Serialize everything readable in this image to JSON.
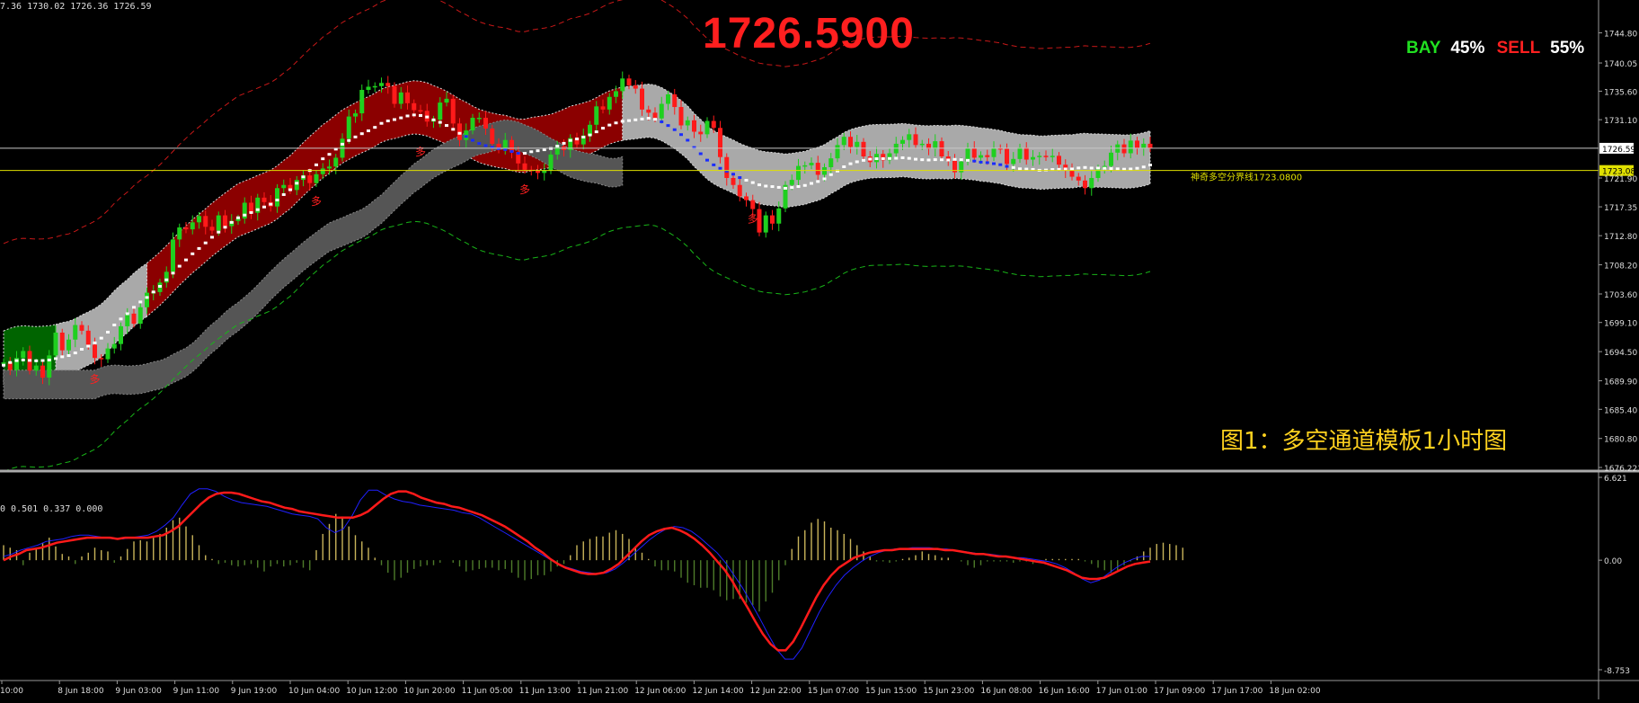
{
  "header": {
    "ohlc_text": "7.36 1730.02 1726.36 1726.59",
    "big_price": "1726.5900",
    "buy_label": "BAY",
    "buy_pct": "45%",
    "sell_label": "SELL",
    "sell_pct": "55%",
    "caption": "图1：多空通道模板1小时图"
  },
  "indicator": {
    "values_text": "0 0.501 0.337 0.000",
    "yticks": [
      "6.621",
      "0.00",
      "-8.753"
    ]
  },
  "colors": {
    "background": "#000000",
    "bull": "#1fd01f",
    "bear": "#ff1a1a",
    "red_band": "#8b0000",
    "green_band": "#006400",
    "gray_band": "#a9a9a9",
    "dark_band": "#555555",
    "price_line": "#c8c8c8",
    "threshold_line": "#e0e000",
    "caption": "#ffd21f"
  },
  "chart_data": {
    "type": "candlestick",
    "title": "",
    "price_ylim": [
      1676.221,
      1748.0
    ],
    "price_yticks": [
      1744.8,
      1740.05,
      1735.6,
      1731.1,
      1726.59,
      1723.08,
      1721.9,
      1717.35,
      1712.8,
      1708.2,
      1703.6,
      1699.1,
      1694.5,
      1689.9,
      1685.4,
      1680.8,
      1676.22
    ],
    "price_ytick_labels": [
      "1744.80",
      "1740.05",
      "1735.60",
      "1731.10",
      "1726.59",
      "1723.08",
      "1721.90",
      "1717.35",
      "1712.80",
      "1708.20",
      "1703.60",
      "1699.10",
      "1694.50",
      "1689.90",
      "1685.40",
      "1680.80",
      "1676.221"
    ],
    "current_price": 1726.59,
    "threshold": {
      "value": 1723.08,
      "label": "神奇多空分界线1723.0800"
    },
    "xticks": [
      "10:00",
      "8 Jun 18:00",
      "9 Jun 03:00",
      "9 Jun 11:00",
      "9 Jun 19:00",
      "10 Jun 04:00",
      "10 Jun 12:00",
      "10 Jun 20:00",
      "11 Jun 05:00",
      "11 Jun 13:00",
      "11 Jun 21:00",
      "12 Jun 06:00",
      "12 Jun 14:00",
      "12 Jun 22:00",
      "15 Jun 07:00",
      "15 Jun 15:00",
      "15 Jun 23:00",
      "16 Jun 08:00",
      "16 Jun 16:00",
      "17 Jun 01:00",
      "17 Jun 09:00",
      "17 Jun 17:00",
      "18 Jun 02:00"
    ],
    "arrow_label": "多",
    "arrows_at": [
      14,
      48,
      64,
      80,
      115,
      178,
      196,
      224
    ],
    "closes": [
      1692.8,
      1691.6,
      1693.5,
      1694.6,
      1691.5,
      1692.3,
      1690.4,
      1693.9,
      1697.5,
      1694.7,
      1696.4,
      1698.7,
      1697.8,
      1695.6,
      1693.5,
      1693.3,
      1695.0,
      1695.7,
      1698.5,
      1700.5,
      1698.9,
      1701.5,
      1703.8,
      1703.9,
      1705.4,
      1707.1,
      1712.2,
      1714.1,
      1713.8,
      1714.9,
      1715.9,
      1714.2,
      1713.6,
      1716.0,
      1714.3,
      1715.1,
      1715.5,
      1718.0,
      1716.4,
      1718.8,
      1718.1,
      1717.4,
      1720.3,
      1720.8,
      1720.0,
      1721.6,
      1722.3,
      1721.1,
      1722.5,
      1723.4,
      1723.7,
      1725.1,
      1728.1,
      1731.6,
      1732.1,
      1735.8,
      1736.3,
      1736.4,
      1736.9,
      1736.4,
      1733.6,
      1735.4,
      1733.7,
      1732.6,
      1732.5,
      1730.8,
      1731.1,
      1733.8,
      1734.4,
      1730.5,
      1727.9,
      1729.4,
      1731.4,
      1731.4,
      1729.7,
      1727.3,
      1726.4,
      1727.9,
      1726.0,
      1724.2,
      1723.2,
      1723.1,
      1722.7,
      1723.1,
      1725.6,
      1726.9,
      1726.3,
      1728.2,
      1727.2,
      1728.6,
      1730.3,
      1733.2,
      1732.7,
      1734.7,
      1735.6,
      1737.6,
      1736.5,
      1736.0,
      1732.7,
      1732.2,
      1731.3,
      1733.6,
      1735.1,
      1733.1,
      1730.2,
      1731.0,
      1729.2,
      1728.8,
      1730.9,
      1729.8,
      1725.2,
      1721.9,
      1720.8,
      1719.0,
      1718.4,
      1717.0,
      1713.3,
      1716.0,
      1714.7,
      1717.1,
      1720.8,
      1721.6,
      1723.8,
      1723.9,
      1724.3,
      1722.4,
      1723.6,
      1725.0,
      1727.1,
      1728.4,
      1726.8,
      1727.6,
      1725.3,
      1724.4,
      1725.7,
      1724.7,
      1725.8,
      1727.3,
      1727.9,
      1728.8,
      1727.1,
      1727.3,
      1726.5,
      1727.7,
      1725.3,
      1724.6,
      1722.8,
      1724.5,
      1726.6,
      1725.1,
      1725.5,
      1725.2,
      1726.6,
      1726.5,
      1724.1,
      1724.9,
      1726.7,
      1724.8,
      1725.2,
      1725.4,
      1725.2,
      1725.4,
      1724.0,
      1723.1,
      1722.1,
      1721.5,
      1720.3,
      1721.9,
      1723.4,
      1723.8,
      1725.9,
      1727.2,
      1725.8,
      1727.8,
      1726.6,
      1727.3,
      1726.6
    ],
    "macd": {
      "ylim": [
        -8.753,
        6.621
      ],
      "histogram": [
        1.2,
        1.0,
        0.8,
        -0.4,
        0.6,
        0.9,
        1.4,
        1.8,
        1.1,
        0.5,
        0.3,
        -0.3,
        0.3,
        0.6,
        1.0,
        0.8,
        0.7,
        -0.2,
        0.3,
        0.9,
        1.5,
        1.6,
        1.5,
        1.8,
        2.1,
        2.6,
        3.2,
        3.4,
        2.7,
        2.0,
        1.2,
        0.4,
        0.1,
        -0.3,
        -0.2,
        -0.4,
        -0.5,
        -0.4,
        -0.3,
        -0.6,
        -0.9,
        -0.5,
        -0.3,
        -0.5,
        -0.4,
        -0.2,
        -0.6,
        -0.8,
        0.8,
        2.1,
        2.9,
        3.7,
        3.5,
        2.7,
        2.0,
        1.5,
        1.0,
        0.2,
        -0.4,
        -1.0,
        -1.6,
        -1.4,
        -1.0,
        -0.7,
        -0.5,
        -0.4,
        -0.4,
        -0.2,
        0.0,
        -0.2,
        -0.5,
        -0.9,
        -0.8,
        -0.7,
        -0.6,
        -0.6,
        -0.8,
        -0.7,
        -1.0,
        -1.4,
        -1.6,
        -1.5,
        -1.2,
        -1.2,
        -0.9,
        -0.5,
        -0.3,
        0.4,
        1.2,
        1.5,
        1.7,
        1.9,
        1.9,
        2.2,
        2.4,
        2.1,
        1.7,
        1.1,
        0.6,
        0.1,
        -0.5,
        -0.8,
        -0.8,
        -0.9,
        -1.4,
        -1.8,
        -2.0,
        -2.2,
        -2.2,
        -2.4,
        -2.9,
        -3.2,
        -3.1,
        -3.1,
        -3.4,
        -3.6,
        -4.1,
        -3.3,
        -2.6,
        -1.6,
        -0.4,
        0.9,
        1.9,
        2.4,
        3.0,
        3.3,
        3.1,
        2.6,
        2.4,
        2.1,
        1.7,
        1.2,
        0.7,
        0.3,
        -0.1,
        -0.1,
        -0.2,
        -0.1,
        0.1,
        0.2,
        0.4,
        0.7,
        0.5,
        0.4,
        0.2,
        0.2,
        0.0,
        -0.1,
        -0.4,
        -0.6,
        -0.4,
        -0.1,
        -0.1,
        -0.1,
        -0.1,
        -0.2,
        -0.1,
        -0.1,
        -0.3,
        -0.2,
        0.1,
        0.1,
        0.1,
        0.1,
        0.1,
        0.1,
        -0.1,
        -0.3,
        -0.6,
        -0.8,
        -1.0,
        -0.8,
        -0.4,
        -0.1,
        0.3,
        0.7,
        1.0,
        1.3,
        1.4,
        1.3,
        1.2,
        1.0
      ],
      "signal": [
        0.0,
        0.3,
        0.5,
        0.8,
        0.9,
        1.0,
        1.2,
        1.4,
        1.5,
        1.6,
        1.7,
        1.8,
        1.8,
        1.8,
        1.8,
        1.7,
        1.8,
        1.8,
        1.8,
        1.8,
        1.9,
        2.0,
        2.3,
        2.7,
        3.3,
        3.9,
        4.5,
        5.0,
        5.3,
        5.4,
        5.4,
        5.3,
        5.1,
        4.9,
        4.7,
        4.6,
        4.4,
        4.2,
        4.1,
        3.9,
        3.8,
        3.7,
        3.6,
        3.5,
        3.4,
        3.4,
        3.4,
        3.6,
        3.9,
        4.4,
        4.9,
        5.3,
        5.5,
        5.5,
        5.3,
        5.0,
        4.8,
        4.6,
        4.5,
        4.3,
        4.2,
        4.0,
        3.8,
        3.6,
        3.3,
        3.0,
        2.7,
        2.3,
        1.9,
        1.5,
        1.0,
        0.6,
        0.1,
        -0.3,
        -0.6,
        -0.8,
        -1.0,
        -1.1,
        -1.1,
        -1.0,
        -0.7,
        -0.3,
        0.3,
        0.9,
        1.5,
        2.0,
        2.3,
        2.5,
        2.6,
        2.4,
        2.1,
        1.7,
        1.2,
        0.6,
        -0.1,
        -0.8,
        -1.7,
        -2.8,
        -3.8,
        -4.9,
        -5.9,
        -6.7,
        -7.2,
        -7.2,
        -6.5,
        -5.4,
        -4.2,
        -3.0,
        -2.0,
        -1.2,
        -0.6,
        -0.2,
        0.2,
        0.4,
        0.6,
        0.7,
        0.8,
        0.8,
        0.9,
        0.9,
        0.9,
        0.9,
        0.9,
        0.9,
        0.8,
        0.8,
        0.7,
        0.6,
        0.5,
        0.5,
        0.4,
        0.3,
        0.3,
        0.2,
        0.1,
        0.0,
        -0.1,
        -0.2,
        -0.4,
        -0.6,
        -0.8,
        -1.1,
        -1.4,
        -1.5,
        -1.5,
        -1.4,
        -1.1,
        -0.8,
        -0.5,
        -0.3,
        -0.2,
        -0.1
      ],
      "macd_line": [
        0.3,
        0.5,
        0.8,
        1.0,
        1.2,
        1.5,
        1.6,
        1.7,
        1.9,
        2.0,
        2.0,
        1.9,
        1.8,
        1.7,
        1.7,
        1.8,
        1.9,
        2.0,
        2.3,
        2.8,
        3.4,
        4.4,
        5.3,
        5.7,
        5.7,
        5.5,
        5.1,
        4.8,
        4.6,
        4.5,
        4.4,
        4.3,
        4.1,
        3.9,
        3.7,
        3.6,
        3.5,
        3.3,
        2.6,
        2.2,
        2.5,
        3.5,
        4.8,
        5.6,
        5.6,
        5.2,
        4.9,
        4.7,
        4.6,
        4.4,
        4.3,
        4.2,
        4.1,
        4.0,
        3.8,
        3.7,
        3.4,
        3.0,
        2.6,
        2.2,
        1.8,
        1.4,
        1.0,
        0.6,
        0.2,
        -0.2,
        -0.5,
        -0.7,
        -0.9,
        -1.0,
        -1.1,
        -1.0,
        -0.7,
        -0.2,
        0.4,
        1.0,
        1.6,
        2.1,
        2.5,
        2.7,
        2.6,
        2.3,
        1.8,
        1.2,
        0.6,
        -0.2,
        -1.2,
        -2.2,
        -3.4,
        -4.6,
        -5.9,
        -7.1,
        -7.9,
        -7.9,
        -7.0,
        -5.6,
        -4.2,
        -3.0,
        -2.0,
        -1.2,
        -0.6,
        -0.1,
        0.3,
        0.6,
        0.8,
        0.9,
        0.9,
        1.0,
        1.0,
        1.0,
        0.9,
        0.9,
        0.8,
        0.7,
        0.6,
        0.5,
        0.5,
        0.4,
        0.3,
        0.2,
        0.2,
        0.1,
        0.0,
        -0.1,
        -0.3,
        -0.6,
        -1.0,
        -1.5,
        -1.8,
        -1.6,
        -1.1,
        -0.6,
        -0.2,
        0.1,
        0.3,
        0.3
      ]
    }
  }
}
